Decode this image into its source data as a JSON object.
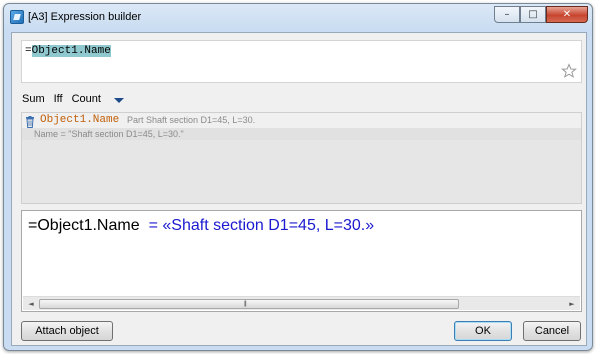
{
  "window": {
    "title": "[A3] Expression builder",
    "min_glyph": "–",
    "max_glyph": "□",
    "close_glyph": "✕"
  },
  "expression": {
    "prefix": "=",
    "selected": "Object1.Name"
  },
  "toolbar": {
    "items": [
      "Sum",
      "Iff",
      "Count"
    ]
  },
  "properties": {
    "object_name": "Object1.Name",
    "object_desc": "Part Shaft section D1=45, L=30.",
    "property_line": "Name = \"Shaft section D1=45, L=30.\""
  },
  "result": {
    "expression": "=Object1.Name",
    "value": "= «Shaft section D1=45, L=30.»"
  },
  "scrollbar": {
    "left_glyph": "◄",
    "right_glyph": "►",
    "grip": "|||"
  },
  "buttons": {
    "attach": "Attach object",
    "ok": "OK",
    "cancel": "Cancel"
  },
  "colors": {
    "object_name": "#c0600a",
    "result_value": "#1a1ad0",
    "selection": "#8fc9cf"
  },
  "icons": {
    "app": "app-icon",
    "favorite": "star-icon",
    "delete": "trash-icon",
    "dropdown": "chevron-down-icon"
  }
}
